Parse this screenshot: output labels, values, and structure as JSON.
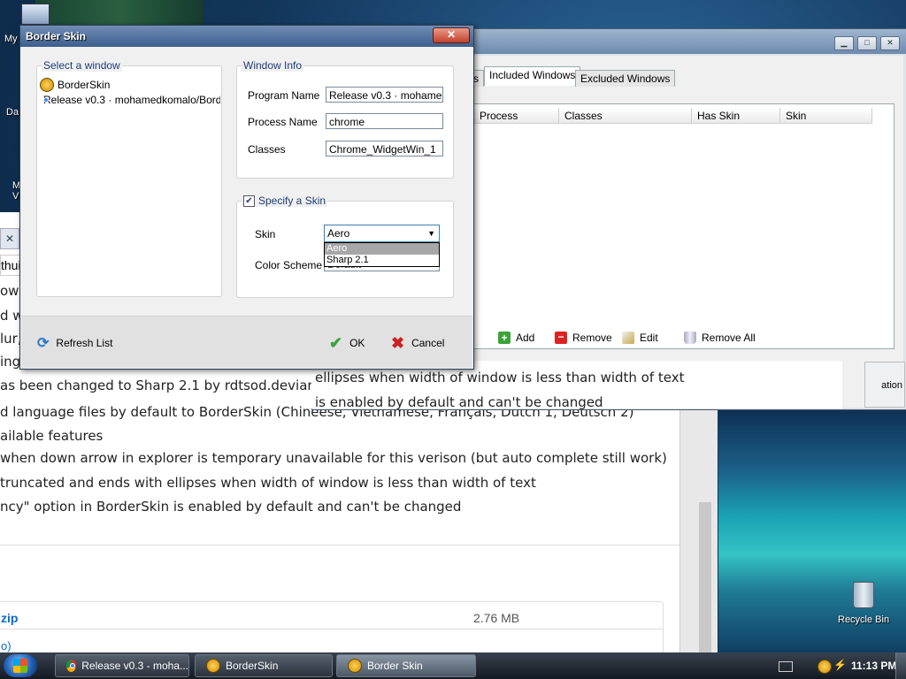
{
  "desktop": {
    "icons": {
      "my_computer_label": "My",
      "data_label": "Da",
      "m_label": "M",
      "v_label": "V",
      "recycle_bin_label": "Recycle Bin"
    }
  },
  "browser": {
    "tab_close": "✕",
    "address_fragment": "thui",
    "lines": [
      "ows",
      "d w",
      "lur,",
      "ing",
      "as been changed to Sharp 2.1 by rdtsod.deviantart.c",
      "d language files by default to BorderSkin (Chineese, Vietnamese, Français, Dutch 1, Deutsch 2)",
      "ailable features",
      " when down arrow in explorer is temporary unavailable for this verison (but auto complete still work)",
      " truncated and ends with ellipses when width of window is less than width of text",
      "ncy\" option in BorderSkin is enabled by default and can't be changed"
    ],
    "file": {
      "name": "zip",
      "size": "2.76 MB",
      "second_row": "o)"
    }
  },
  "main_window": {
    "tabs": [
      "s",
      "Included Windows",
      "Excluded Windows"
    ],
    "columns": [
      "Process",
      "Classes",
      "Has Skin",
      "Skin"
    ],
    "toolbar": {
      "add": "Add",
      "remove": "Remove",
      "edit": "Edit",
      "remove_all": "Remove All"
    },
    "text_lines": [
      "ellipses when width of window is less than width of text",
      "is enabled by default and can't be changed"
    ],
    "side_label": "ation"
  },
  "dialog": {
    "title": "Border Skin",
    "close": "✕",
    "select_window": {
      "legend": "Select a window",
      "items": [
        {
          "label": "BorderSkin",
          "icon": "borderskin-icon"
        },
        {
          "label": "Release v0.3 · mohamedkomalo/Border",
          "icon": "chrome-icon"
        }
      ]
    },
    "window_info": {
      "legend": "Window Info",
      "program_name_label": "Program Name",
      "program_name_value": "Release v0.3 · mohamedkomalo",
      "process_name_label": "Process Name",
      "process_name_value": "chrome",
      "classes_label": "Classes",
      "classes_value": "Chrome_WidgetWin_1"
    },
    "specify_skin": {
      "legend": "Specify a Skin",
      "checked": true,
      "skin_label": "Skin",
      "skin_value": "Aero",
      "skin_options": [
        "Aero",
        "Sharp 2.1"
      ],
      "color_scheme_label": "Color Scheme",
      "color_scheme_value": "Default"
    },
    "buttons": {
      "refresh": "Refresh List",
      "ok": "OK",
      "cancel": "Cancel"
    }
  },
  "taskbar": {
    "tasks": [
      {
        "label": "Release v0.3 - moha...",
        "icon": "chrome-icon"
      },
      {
        "label": "BorderSkin",
        "icon": "borderskin-icon"
      },
      {
        "label": "Border Skin",
        "icon": "borderskin-icon",
        "active": true
      }
    ],
    "clock": "11:13 PM"
  }
}
